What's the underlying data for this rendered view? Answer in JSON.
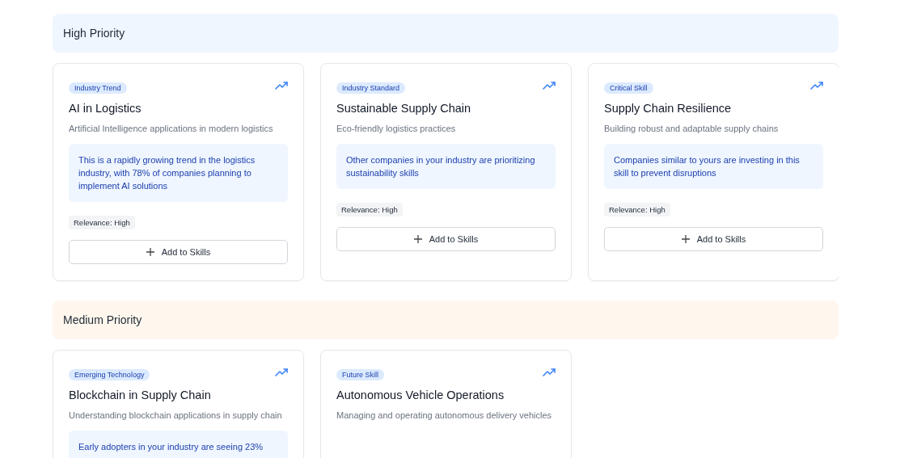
{
  "sections": [
    {
      "title": "High Priority",
      "kind": "high",
      "cards": [
        {
          "badge": "Industry Trend",
          "title": "AI in Logistics",
          "description": "Artificial Intelligence applications in modern logistics",
          "insight": "This is a rapidly growing trend in the logistics industry, with 78% of companies planning to implement AI solutions",
          "relevance": "Relevance: High",
          "button": "Add to Skills"
        },
        {
          "badge": "Industry Standard",
          "title": "Sustainable Supply Chain",
          "description": "Eco-friendly logistics practices",
          "insight": "Other companies in your industry are prioritizing sustainability skills",
          "relevance": "Relevance: High",
          "button": "Add to Skills"
        },
        {
          "badge": "Critical Skill",
          "title": "Supply Chain Resilience",
          "description": "Building robust and adaptable supply chains",
          "insight": "Companies similar to yours are investing in this skill to prevent disruptions",
          "relevance": "Relevance: High",
          "button": "Add to Skills"
        }
      ]
    },
    {
      "title": "Medium Priority",
      "kind": "medium",
      "cards": [
        {
          "badge": "Emerging Technology",
          "title": "Blockchain in Supply Chain",
          "description": "Understanding blockchain applications in supply chain",
          "insight": "Early adopters in your industry are seeing 23%"
        },
        {
          "badge": "Future Skill",
          "title": "Autonomous Vehicle Operations",
          "description": "Managing and operating autonomous delivery vehicles"
        }
      ]
    }
  ]
}
